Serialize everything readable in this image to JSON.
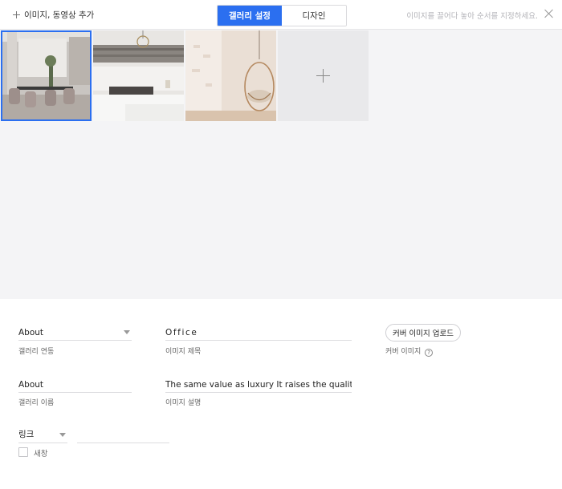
{
  "topbar": {
    "add_media_label": "이미지, 동영상 추가",
    "tabs": [
      {
        "label": "갤러리 설정",
        "active": true
      },
      {
        "label": "디자인",
        "active": false
      }
    ],
    "hint": "이미지를 끌어다 놓아 순서를 지정하세요."
  },
  "gallery": {
    "images": [
      {
        "icon": "office-photo",
        "selected": true
      },
      {
        "icon": "kitchen-photo",
        "selected": false
      },
      {
        "icon": "hanging-chair-photo",
        "selected": false
      }
    ]
  },
  "form": {
    "gallery_link": {
      "value": "About",
      "label": "갤러리 연동"
    },
    "gallery_name": {
      "value": "About",
      "label": "갤러리 이름"
    },
    "image_title": {
      "value": "Office",
      "label": "이미지 제목"
    },
    "image_description": {
      "value": "The same value as luxury It raises the quality of the l",
      "label": "이미지 설명"
    },
    "cover": {
      "button_label": "커버 이미지 업로드",
      "label": "커버 이미지",
      "help_icon": "?"
    },
    "link": {
      "type_value": "링크",
      "url_value": ""
    },
    "new_window": {
      "label": "새창",
      "checked": false
    }
  },
  "colors": {
    "accent": "#2b6ff0",
    "gallery_bg": "#f4f4f6"
  }
}
